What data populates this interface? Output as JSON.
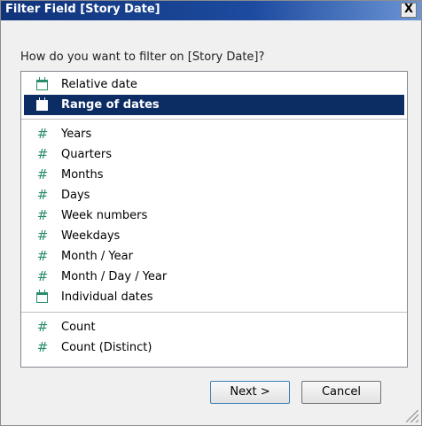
{
  "window": {
    "title": "Filter Field [Story Date]",
    "close_label": "X"
  },
  "prompt": "How do you want to filter on [Story Date]?",
  "groups": [
    {
      "items": [
        {
          "label": "Relative date",
          "icon": "calendar-icon",
          "selected": false
        },
        {
          "label": "Range of dates",
          "icon": "calendar-icon",
          "selected": true
        }
      ]
    },
    {
      "items": [
        {
          "label": "Years",
          "icon": "hash-icon",
          "selected": false
        },
        {
          "label": "Quarters",
          "icon": "hash-icon",
          "selected": false
        },
        {
          "label": "Months",
          "icon": "hash-icon",
          "selected": false
        },
        {
          "label": "Days",
          "icon": "hash-icon",
          "selected": false
        },
        {
          "label": "Week numbers",
          "icon": "hash-icon",
          "selected": false
        },
        {
          "label": "Weekdays",
          "icon": "hash-icon",
          "selected": false
        },
        {
          "label": "Month / Year",
          "icon": "hash-icon",
          "selected": false
        },
        {
          "label": "Month / Day / Year",
          "icon": "hash-icon",
          "selected": false
        },
        {
          "label": "Individual dates",
          "icon": "calendar-icon",
          "selected": false
        }
      ]
    },
    {
      "items": [
        {
          "label": "Count",
          "icon": "hash-icon",
          "selected": false
        },
        {
          "label": "Count (Distinct)",
          "icon": "hash-icon",
          "selected": false
        }
      ]
    }
  ],
  "buttons": {
    "next": "Next >",
    "cancel": "Cancel"
  },
  "colors": {
    "selection": "#0c2d64",
    "icon": "#2a8d6a",
    "titlebar": "#10337a"
  }
}
